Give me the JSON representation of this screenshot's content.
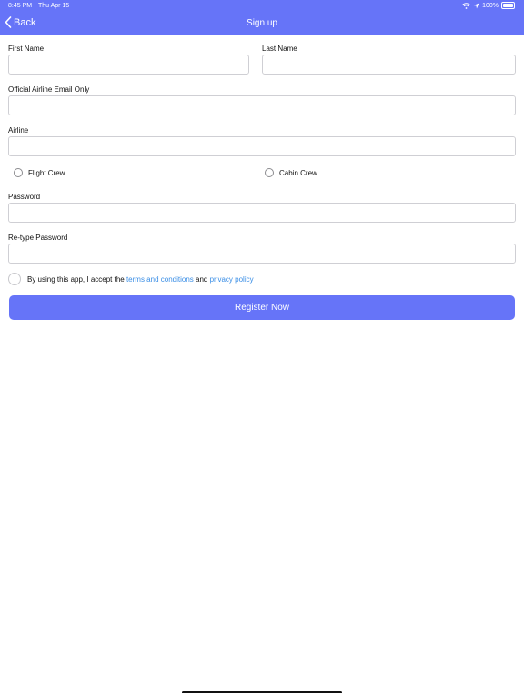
{
  "status_bar": {
    "time": "8:45 PM",
    "date": "Thu Apr 15",
    "battery": "100%"
  },
  "nav": {
    "back_label": "Back",
    "title": "Sign up"
  },
  "form": {
    "first_name_label": "First Name",
    "last_name_label": "Last Name",
    "email_label": "Official Airline Email Only",
    "airline_label": "Airline",
    "crew_options": [
      "Flight Crew",
      "Cabin Crew"
    ],
    "password_label": "Password",
    "retype_password_label": "Re-type Password",
    "terms": {
      "prefix": "By using this app, I accept the ",
      "terms_link": "terms and conditions",
      "middle": " and ",
      "privacy_link": "privacy policy"
    },
    "register_label": "Register Now"
  },
  "colors": {
    "accent": "#6674f8",
    "link": "#3a8ee6"
  }
}
